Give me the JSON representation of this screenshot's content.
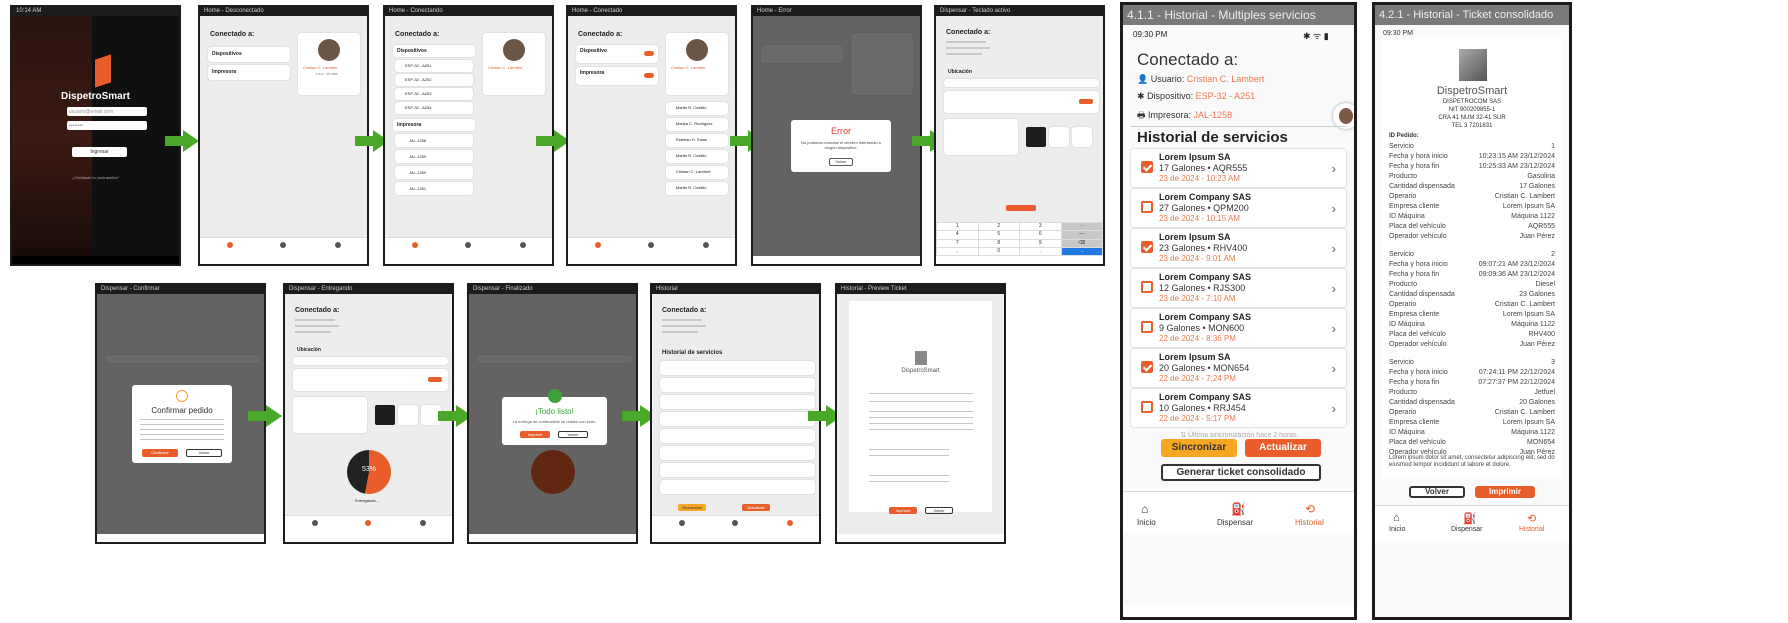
{
  "brand": {
    "name": "DispetroSmart",
    "accent": "#e95d2b",
    "arrow_green": "#4aa829"
  },
  "login": {
    "status_time": "10:14 AM",
    "email_placeholder": "usuario@email.com",
    "password_placeholder": "••••••••",
    "login_button": "Ingresar",
    "forgot_link": "¿Olvidaste tu contraseña?"
  },
  "screens": {
    "home_disconnected": {
      "title": "Home - Desconectado",
      "connected_to": "Conectado a:",
      "devices": "Dispositivos",
      "printer": "Impresora",
      "user_name": "Cristian C. Lambert",
      "user_role": "Lect. Ventas"
    },
    "home_connecting": {
      "title": "Home - Conectando",
      "connected_to": "Conectado a:",
      "devices": "Dispositivos",
      "printer": "Impresora",
      "user_name": "Cristian C. Lambert",
      "device_items": [
        "ESP-32 - A251",
        "ESP-32 - A252",
        "ESP-32 - A253",
        "ESP-32 - A254"
      ],
      "printer_items": [
        "JAL-1258",
        "JAL-1259",
        "JAL-1260",
        "JAL-1261"
      ]
    },
    "home_connected": {
      "title": "Home - Conectado",
      "connected_to": "Conectado a:",
      "devices": "Dispositivo",
      "printer": "Impresora",
      "user_name": "Cristian C. Lambert",
      "operators": [
        "Martin R. Castillo",
        "Marisa C. Rodriguez",
        "Esteban H. Salas",
        "Martin R. Castillo",
        "Cristian C. Lambert",
        "Martin R. Castillo"
      ]
    },
    "home_error": {
      "title": "Home - Error",
      "heading": "Error",
      "message": "No pudimos conectar el cerebro intentando a ningún dispositivo.",
      "button": "Volver"
    },
    "dispense_keyboard": {
      "title": "Dispensar - Teclado activo",
      "connected_to": "Conectado a:",
      "location": "Ubicación",
      "keys": [
        "1",
        "2",
        "3",
        "-",
        "4",
        "5",
        "6",
        "—",
        "7",
        "8",
        "9",
        "⌫",
        ",",
        "0",
        ".",
        "→"
      ]
    },
    "dispense_confirm": {
      "title": "Dispensar - Confirmar",
      "heading": "Confirmar pedido",
      "confirm_button": "Confirmar",
      "cancel_button": "Volver"
    },
    "dispense_progress": {
      "title": "Dispensar - Entregando",
      "connected_to": "Conectado a:",
      "location": "Ubicación",
      "percent": "53%",
      "status": "Entregando..."
    },
    "dispense_done": {
      "title": "Dispensar - Finalizado",
      "heading": "¡Todo listo!",
      "message": "La entrega de combustible se realizó con éxito.",
      "print_button": "Imprimir",
      "back_button": "Volver"
    },
    "history": {
      "title": "Historial",
      "connected_to": "Conectado a:",
      "heading": "Historial de servicios",
      "sync": "Sincronizar",
      "update": "Actualizar"
    },
    "ticket_preview": {
      "title": "Historial - Preview Ticket",
      "print": "Imprimir",
      "back": "Volver"
    }
  },
  "history_multi": {
    "caption": "4.1.1 - Historial - Multiples servicios",
    "time": "09:30 PM",
    "connected_to": "Conectado a:",
    "user_label": "Usuario:",
    "user_value": "Cristian C. Lambert",
    "device_label": "Dispositivo:",
    "device_value": "ESP-32 - A251",
    "printer_label": "Impresora:",
    "printer_value": "JAL-1258",
    "heading": "Historial de servicios",
    "items": [
      {
        "company": "Lorem Ipsum SA",
        "detail": "17 Galones • AQR555",
        "date": "23 de 2024 - 10:23 AM",
        "checked": true
      },
      {
        "company": "Lorem Company SAS",
        "detail": "27 Galones • QPM200",
        "date": "23 de 2024 - 10:15 AM",
        "checked": false
      },
      {
        "company": "Lorem Ipsum SA",
        "detail": "23 Galones • RHV400",
        "date": "23 de 2024 - 9:01 AM",
        "checked": true
      },
      {
        "company": "Lorem Company SAS",
        "detail": "12 Galones • RJS300",
        "date": "23 de 2024 - 7:10 AM",
        "checked": false
      },
      {
        "company": "Lorem Company SAS",
        "detail": "9 Galones • MON600",
        "date": "22 de 2024 - 8:36 PM",
        "checked": false
      },
      {
        "company": "Lorem Ipsum SA",
        "detail": "20 Galones • MON654",
        "date": "22 de 2024 - 7:24 PM",
        "checked": true
      },
      {
        "company": "Lorem Company SAS",
        "detail": "10 Galones • RRJ454",
        "date": "22 de 2024 - 5:17 PM",
        "checked": false
      }
    ],
    "last_sync": "Última sincronización hace 2 horas",
    "sync_button": "Sincronizar",
    "update_button": "Actualizar",
    "ticket_button": "Generar ticket consolidado",
    "tabs": [
      "Inicio",
      "Dispensar",
      "Historial"
    ]
  },
  "ticket": {
    "caption": "4.2.1 - Historial - Ticket consolidado",
    "time": "09:30 PM",
    "brand": "DispetroSmart",
    "company": "DISPETROCOM SAS",
    "nit": "NIT 900209855-1",
    "address": "CRA 41 NUM 32-41 SUR",
    "phone": "TEL 3 7201831",
    "order_label": "ID Pedido:",
    "services": [
      [
        [
          "Servicio",
          "1"
        ],
        [
          "Fecha y hora inicio",
          "10:23:15 AM 23/12/2024"
        ],
        [
          "Fecha y hora fin",
          "10:25:33 AM 23/12/2024"
        ],
        [
          "Producto",
          "Gasolina"
        ],
        [
          "Cantidad dispensada",
          "17 Galones"
        ],
        [
          "Operario",
          "Cristian C. Lambert"
        ],
        [
          "Empresa cliente",
          "Lorem Ipsum SA"
        ],
        [
          "ID Máquina",
          "Máquina 1122"
        ],
        [
          "Placa del vehículo",
          "AQR555"
        ],
        [
          "Operador vehículo",
          "Juan Pérez"
        ]
      ],
      [
        [
          "Servicio",
          "2"
        ],
        [
          "Fecha y hora inicio",
          "09:07:21 AM 23/12/2024"
        ],
        [
          "Fecha y hora fin",
          "09:09:36 AM 23/12/2024"
        ],
        [
          "Producto",
          "Diesel"
        ],
        [
          "Cantidad dispensada",
          "23 Galones"
        ],
        [
          "Operario",
          "Cristian C. Lambert"
        ],
        [
          "Empresa cliente",
          "Lorem Ipsum SA"
        ],
        [
          "ID Máquina",
          "Máquina 1122"
        ],
        [
          "Placa del vehículo",
          "RHV400"
        ],
        [
          "Operador vehículo",
          "Juan Pérez"
        ]
      ],
      [
        [
          "Servicio",
          "3"
        ],
        [
          "Fecha y hora inicio",
          "07:24:11 PM 22/12/2024"
        ],
        [
          "Fecha y hora fin",
          "07:27:37 PM 22/12/2024"
        ],
        [
          "Producto",
          "Jetfuel"
        ],
        [
          "Cantidad dispensada",
          "20 Galones"
        ],
        [
          "Operario",
          "Cristian C. Lambert"
        ],
        [
          "Empresa cliente",
          "Lorem Ipsum SA"
        ],
        [
          "ID Máquina",
          "Máquina 1122"
        ],
        [
          "Placa del vehículo",
          "MON654"
        ],
        [
          "Operador vehículo",
          "Juan Pérez"
        ]
      ]
    ],
    "footer": "Lorem ipsum dolor sit amet, consectetur adipiscing elit, sed do eiusmod tempor incididunt ut labore et dolore.",
    "back_button": "Volver",
    "print_button": "Imprimir",
    "tabs": [
      "Inicio",
      "Dispensar",
      "Historial"
    ]
  }
}
